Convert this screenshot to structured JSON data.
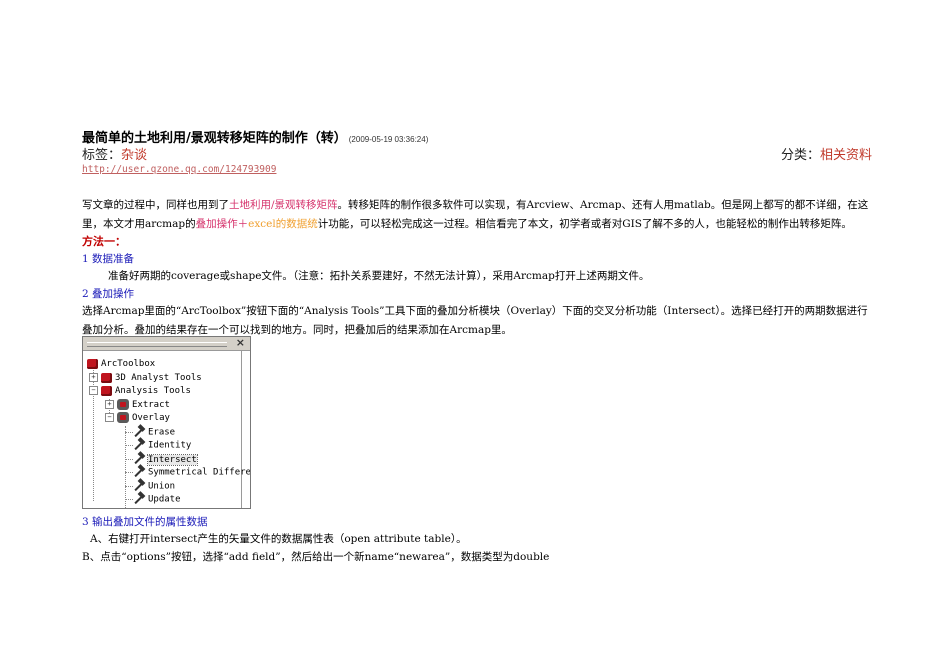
{
  "article": {
    "title": "最简单的土地利用/景观转移矩阵的制作（转）",
    "date": "(2009-05-19 03:36:24)",
    "tags_label": "标签：",
    "tags_value": "杂谈",
    "category_label": "分类：",
    "category_value": "相关资料",
    "url": "http://user.qzone.qq.com/124793909"
  },
  "intro": {
    "t1": "写文章的过程中，同样也用到了",
    "link1": "土地利用/景观转移矩阵",
    "t2": "。转移矩阵的制作很多软件可以实现，有Arcview、Arcmap、还有人用matlab。但是网上都写的都不详细，在这里，本文才用arcmap的",
    "link2": "叠加操作＋",
    "link3": "excel的数据统",
    "t3": "计功能，可以轻松完成这一过程。相信看完了本文，初学者或者对GIS了解不多的人，也能轻松的制作出转移矩阵。"
  },
  "method": {
    "heading": "方法一："
  },
  "section1": {
    "heading": "1  数据准备",
    "text": "准备好两期的coverage或shape文件。（注意：拓扑关系要建好，不然无法计算），采用Arcmap打开上述两期文件。"
  },
  "section2": {
    "heading": "2  叠加操作",
    "text": "选择Arcmap里面的“ArcToolbox”按钮下面的“Analysis Tools”工具下面的叠加分析模块（Overlay）下面的交叉分析功能（Intersect）。选择已经打开的两期数据进行叠加分析。叠加的结果存在一个可以找到的地方。同时，把叠加后的结果添加在Arcmap里。"
  },
  "toolbox": {
    "close": "×",
    "root": "ArcToolbox",
    "items": [
      "3D Analyst Tools",
      "Analysis Tools",
      "Extract",
      "Overlay",
      "Erase",
      "Identity",
      "Intersect",
      "Symmetrical Differe",
      "Union",
      "Update"
    ],
    "plus": "+",
    "minus": "−"
  },
  "section3": {
    "heading": "3  输出叠加文件的属性数据",
    "line_a": "A、右键打开intersect产生的矢量文件的数据属性表（open attribute table）。",
    "line_b": "B、点击“options”按钮，选择“add field”，然后给出一个新name“newarea”，数据类型为double"
  },
  "colors": {
    "link": "#d6336c",
    "excel": "#f0a030",
    "heading": "#1a1ab8",
    "method": "#c00000",
    "icon": "#c0141e"
  }
}
